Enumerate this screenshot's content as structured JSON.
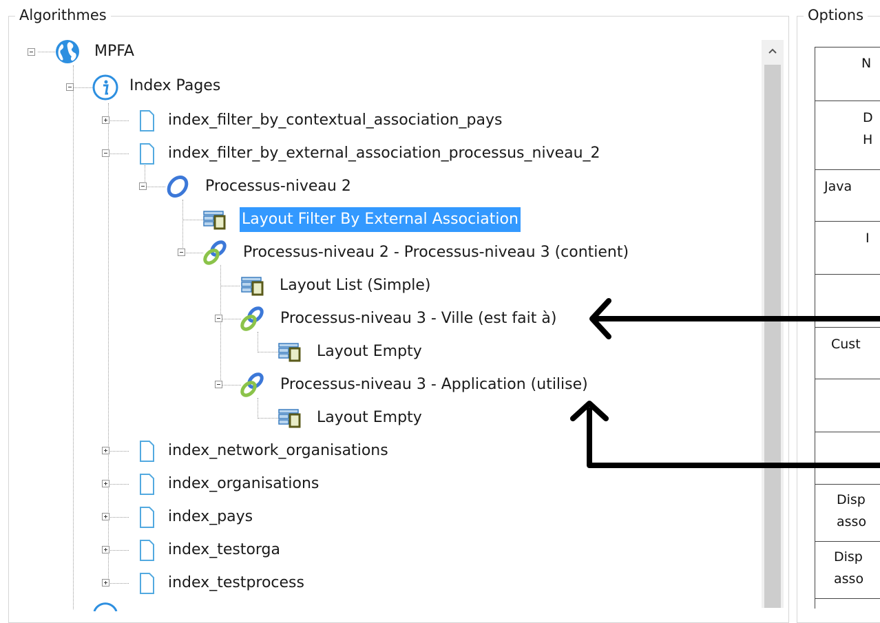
{
  "groups": {
    "algorithms_title": "Algorithmes",
    "options_title": "Options"
  },
  "tree": {
    "root": "MPFA",
    "index_pages": "Index Pages",
    "items": [
      "index_filter_by_contextual_association_pays",
      "index_filter_by_external_association_processus_niveau_2",
      "Processus-niveau 2",
      "Layout Filter By External Association",
      "Processus-niveau 2 - Processus-niveau 3 (contient)",
      "Layout List (Simple)",
      "Processus-niveau 3 - Ville (est fait à)",
      "Layout Empty",
      "Processus-niveau 3 - Application (utilise)",
      "Layout Empty",
      "index_network_organisations",
      "index_organisations",
      "index_pays",
      "index_testorga",
      "index_testprocess"
    ]
  },
  "options_table": {
    "rows": [
      "N",
      "D",
      "H",
      "Java",
      "I",
      "Cust",
      "Disp",
      "asso",
      "Disp",
      "asso"
    ]
  },
  "colors": {
    "selection": "#3399ff",
    "link_blue": "#3c78d8",
    "link_green": "#8bc34a",
    "globe_blue": "#2d8fe0"
  }
}
